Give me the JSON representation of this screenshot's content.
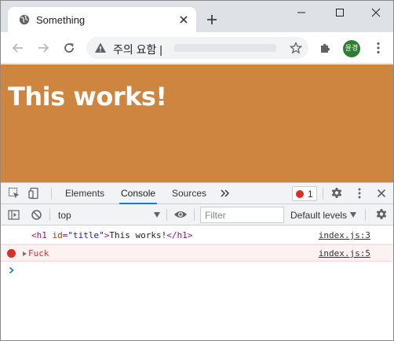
{
  "browser": {
    "tab_title": "Something",
    "omnibox_security_label": "주의 요함 |",
    "avatar_text": "윤경"
  },
  "page": {
    "heading": "This works!",
    "background_color": "#cd853f"
  },
  "devtools": {
    "tabs": [
      "Elements",
      "Console",
      "Sources"
    ],
    "active_tab": "Console",
    "error_count": "1",
    "context": "top",
    "filter_placeholder": "Filter",
    "levels_label": "Default levels",
    "messages": [
      {
        "type": "log",
        "tag_open": "<h1",
        "attr_name": "id",
        "attr_value": "\"title\"",
        "tag_close_start": ">",
        "content": "This works!",
        "tag_end": "</h1>",
        "source": "index.js:3"
      },
      {
        "type": "error",
        "text": "Fuck",
        "source": "index.js:5"
      }
    ]
  },
  "colors": {
    "accent": "#1a73e8",
    "error": "#d93025",
    "tabstrip": "#dee1e6"
  },
  "icons": {
    "favicon": "globe-icon",
    "warning": "warning-icon",
    "star": "star-icon",
    "extensions": "puzzle-icon"
  }
}
